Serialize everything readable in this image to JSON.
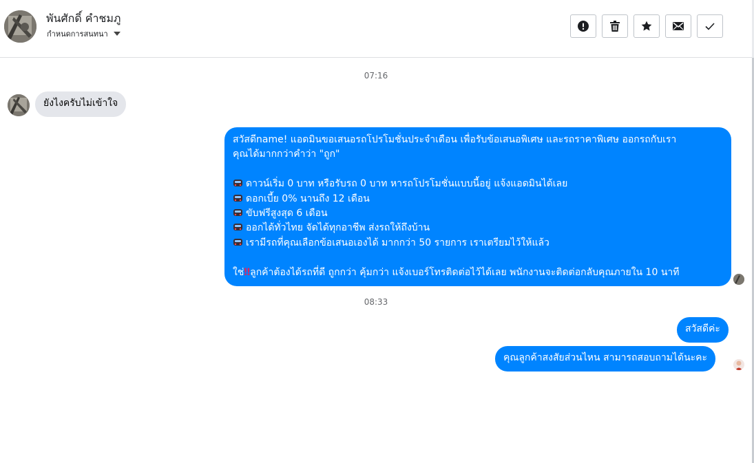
{
  "header": {
    "contact_name": "พันศักดิ์ คำชมภู",
    "conversation_status": "กำหนดการสนทนา",
    "toolbar": [
      {
        "icon": "alert-icon",
        "name": "mark-spam-button"
      },
      {
        "icon": "trash-icon",
        "name": "delete-button"
      },
      {
        "icon": "star-icon",
        "name": "star-button"
      },
      {
        "icon": "envelope-icon",
        "name": "mark-unread-button"
      },
      {
        "icon": "check-icon",
        "name": "mark-done-button"
      }
    ]
  },
  "timestamps": {
    "first": "07:16",
    "second": "08:33"
  },
  "messages": {
    "incoming": "ยังไงครับไม่เข้าใจ",
    "promo": {
      "line1": "สวัสดีname! แอดมินขอเสนอรถโปรโมชั่นประจำเดือน เพื่อรับข้อเสนอพิเศษ และรถราคาพิเศษ ออกรถกับเรา",
      "line2": "คุณได้มากกว่าคำว่า \"ถูก\"",
      "bullet_emoji": "car-emoji-icon",
      "bullets": [
        "ดาวน์เริ่ม 0 บาท หรือรับรถ 0 บาท หารถโปรโมชั่นแบบนี้อยู่ แจ้งแอดมินได้เลย",
        "ดอกเบี้ย 0% นานถึง 12 เดือน",
        "ขับฟรีสูงสุด 6 เดือน",
        "ออกได้ทั่วไทย จัดได้ทุกอาชีพ ส่งรถให้ถึงบ้าน",
        "เรามีรถที่คุณเลือกข้อเสนอเองได้ มากกว่า 50 รายการ เราเตรียมไว้ให้แล้ว"
      ],
      "closing_prefix": "ใช่",
      "closing_mark": "‼",
      "closing_rest": "ลูกค้าต้องได้รถที่ดี ถูกกว่า คุ้มกว่า แจ้งเบอร์โทรติดต่อไว้ได้เลย พนักงานจะติดต่อกลับคุณภายใน 10 นาที"
    },
    "hello": "สวัสดีค่ะ",
    "ask_area": "คุณลูกค้าสงสัยส่วนไหน สามารถสอบถามได้นะคะ"
  },
  "colors": {
    "outgoing": "#0084ff",
    "incoming": "#e4e6eb",
    "timestamp": "#65676b"
  }
}
